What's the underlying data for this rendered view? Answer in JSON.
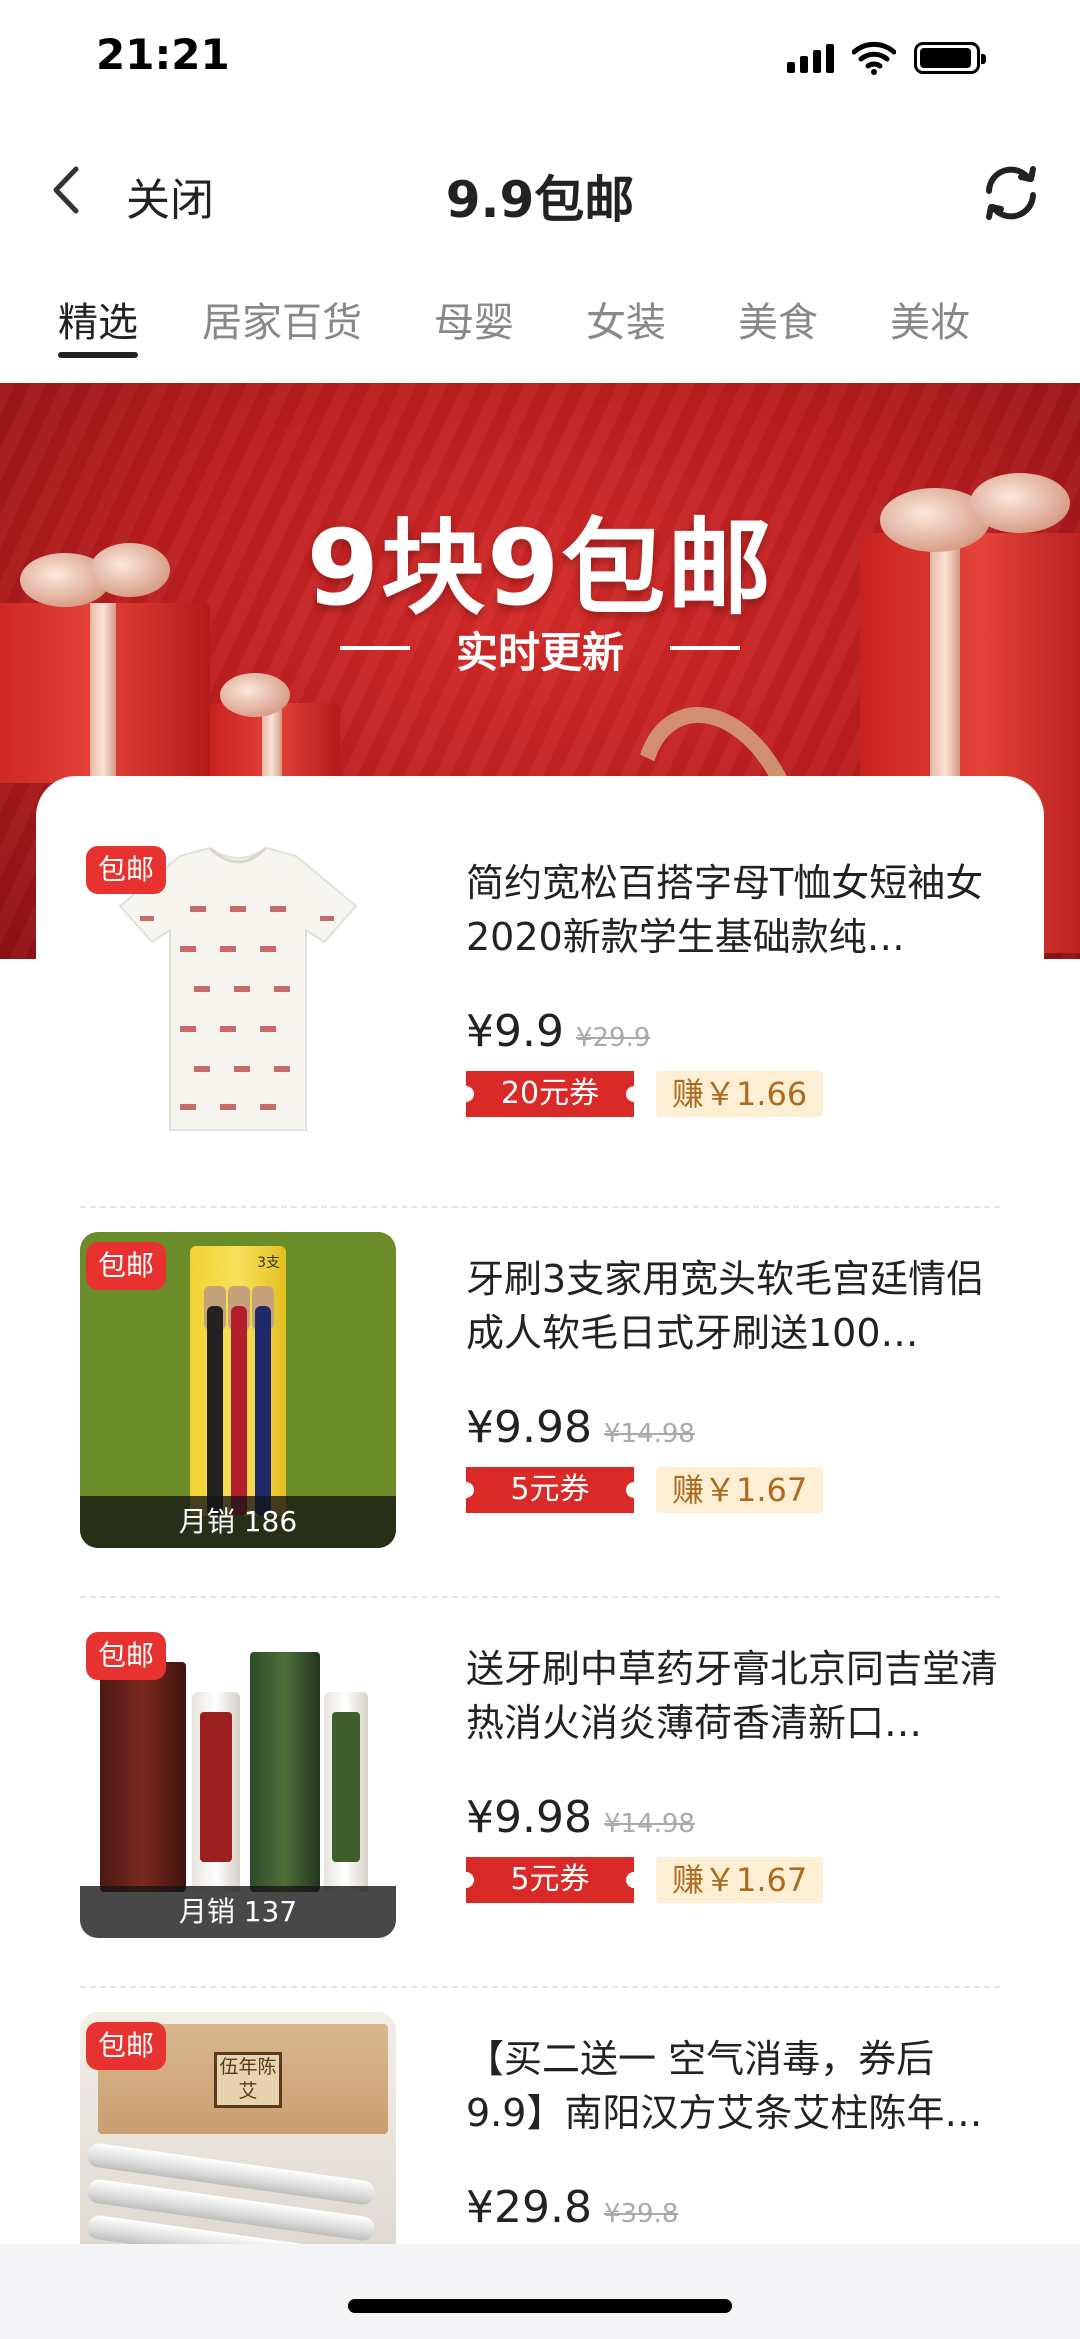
{
  "status_bar": {
    "time": "21:21",
    "battery_level": 0.95
  },
  "nav": {
    "close_label": "关闭",
    "title": "9.9包邮"
  },
  "tabs": [
    "精选",
    "居家百货",
    "母婴",
    "女装",
    "美食",
    "美妆"
  ],
  "active_tab": "精选",
  "banner": {
    "title": "9块9包邮",
    "subtitle": "实时更新"
  },
  "products": [
    {
      "badge": "包邮",
      "title": "简约宽松百搭字母T恤女短袖女2020新款学生基础款纯…",
      "price": "¥9.9",
      "original_price": "¥29.9",
      "coupon": "20元券",
      "earn": "赚￥1.66",
      "sales": ""
    },
    {
      "badge": "包邮",
      "title": "牙刷3支家用宽头软毛宫廷情侣成人软毛日式牙刷送100…",
      "price": "¥9.98",
      "original_price": "¥14.98",
      "coupon": "5元券",
      "earn": "赚￥1.67",
      "sales": "月销 186"
    },
    {
      "badge": "包邮",
      "title": "送牙刷中草药牙膏北京同吉堂清热消火消炎薄荷香清新口…",
      "price": "¥9.98",
      "original_price": "¥14.98",
      "coupon": "5元券",
      "earn": "赚￥1.67",
      "sales": "月销 137"
    },
    {
      "badge": "包邮",
      "title": "【买二送一 空气消毒，券后9.9】南阳汉方艾条艾柱陈年…",
      "price": "¥29.8",
      "original_price": "¥39.8",
      "coupon": "",
      "earn": "",
      "sales": ""
    }
  ],
  "product_images": {
    "pack_label": "3支",
    "moxa_label": "伍年陈艾"
  },
  "colors": {
    "accent_red": "#e8322f",
    "coupon_red": "#d92a28",
    "earn_bg": "#fcefd4",
    "earn_text": "#b06a1f",
    "banner_red": "#c42222"
  },
  "icons": {
    "back": "chevron-left-icon",
    "refresh": "refresh-icon",
    "signal": "signal-icon",
    "wifi": "wifi-icon",
    "battery": "battery-icon"
  }
}
